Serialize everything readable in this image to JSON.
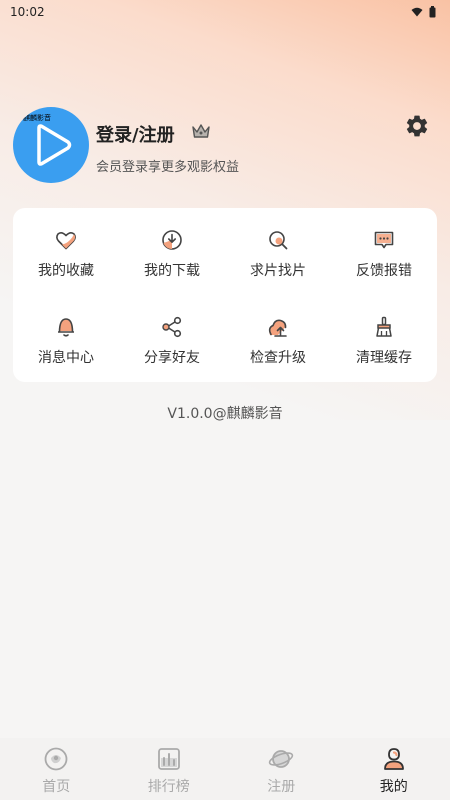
{
  "status_bar": {
    "time": "10:02"
  },
  "profile": {
    "avatar_caption": "麒麟影音",
    "login_title": "登录/注册",
    "login_subtitle": "会员登录享更多观影权益"
  },
  "menu": {
    "items": [
      {
        "label": "我的收藏",
        "icon": "heart-icon"
      },
      {
        "label": "我的下载",
        "icon": "download-icon"
      },
      {
        "label": "求片找片",
        "icon": "search-icon"
      },
      {
        "label": "反馈报错",
        "icon": "feedback-icon"
      },
      {
        "label": "消息中心",
        "icon": "bell-icon"
      },
      {
        "label": "分享好友",
        "icon": "share-icon"
      },
      {
        "label": "检查升级",
        "icon": "upgrade-icon"
      },
      {
        "label": "清理缓存",
        "icon": "broom-icon"
      }
    ]
  },
  "version_text": "V1.0.0@麒麟影音",
  "tabbar": {
    "tabs": [
      {
        "label": "首页",
        "icon": "home-icon",
        "active": false
      },
      {
        "label": "排行榜",
        "icon": "ranking-icon",
        "active": false
      },
      {
        "label": "注册",
        "icon": "planet-icon",
        "active": false
      },
      {
        "label": "我的",
        "icon": "user-icon",
        "active": true
      }
    ]
  },
  "colors": {
    "accent": "#f4a27e",
    "avatar_bg": "#3a9ef0",
    "icon_stroke": "#444444"
  }
}
